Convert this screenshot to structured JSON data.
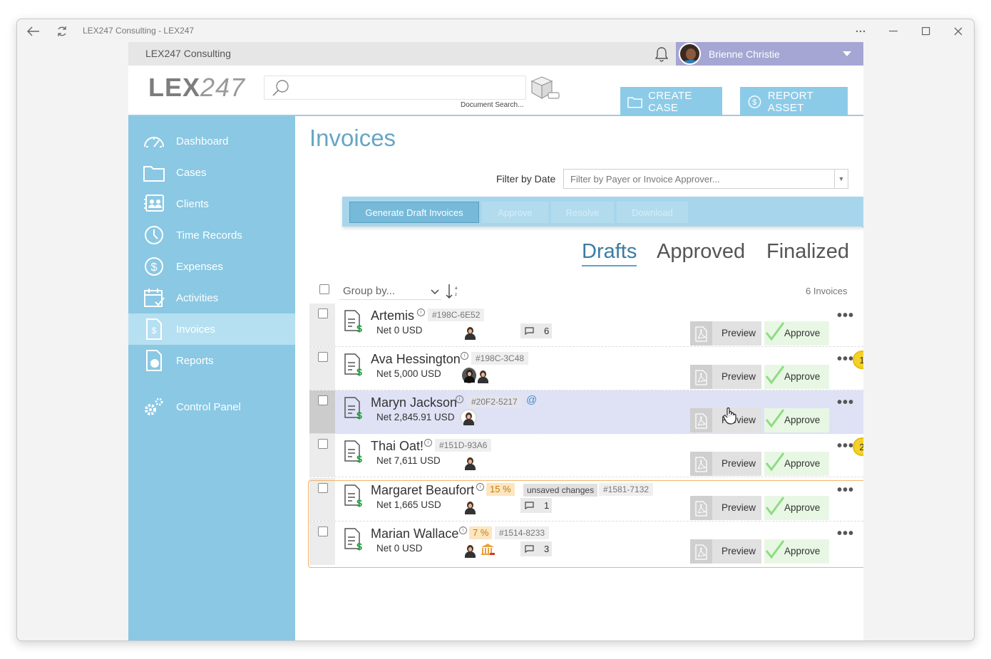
{
  "window": {
    "title": "LEX247 Consulting - LEX247"
  },
  "topbar": {
    "firm": "LEX247 Consulting",
    "user": "Brienne Christie"
  },
  "header": {
    "logo_bold": "LEX",
    "logo_light": "247",
    "search_caption": "Document Search...",
    "create_case": "CREATE CASE",
    "report_asset": "REPORT ASSET"
  },
  "sidebar": {
    "items": [
      {
        "label": "Dashboard",
        "icon": "gauge-icon"
      },
      {
        "label": "Cases",
        "icon": "folder-icon"
      },
      {
        "label": "Clients",
        "icon": "contacts-icon"
      },
      {
        "label": "Time Records",
        "icon": "clock-icon"
      },
      {
        "label": "Expenses",
        "icon": "dollar-icon"
      },
      {
        "label": "Activities",
        "icon": "calendar-icon"
      },
      {
        "label": "Invoices",
        "icon": "invoice-icon",
        "active": true
      },
      {
        "label": "Reports",
        "icon": "report-icon"
      },
      {
        "label": "Control Panel",
        "icon": "gears-icon"
      }
    ]
  },
  "main": {
    "title": "Invoices",
    "filter_label": "Filter by Date",
    "filter_placeholder": "Filter by Payer or Invoice Approver...",
    "toolbar": {
      "generate": "Generate Draft Invoices",
      "approve": "Approve",
      "resolve": "Resolve",
      "download": "Download"
    },
    "tabs": [
      "Drafts",
      "Approved",
      "Finalized"
    ],
    "active_tab": "Drafts",
    "group_by": "Group by...",
    "count": "6 Invoices",
    "preview_label": "Preview",
    "approve_label": "Approve",
    "invoices": [
      {
        "name": "Artemis",
        "id": "#198C-6E52",
        "net": "Net 0 USD",
        "comments": "6"
      },
      {
        "name": "Ava Hessington",
        "id": "#198C-3C48",
        "net": "Net 5,000 USD",
        "badge": "1"
      },
      {
        "name": "Maryn Jackson",
        "id": "#20F2-5217",
        "net": "Net 2,845.91 USD",
        "mention": "@"
      },
      {
        "name": "Thai Oat!",
        "id": "#151D-93A6",
        "net": "Net 7,611 USD",
        "badge": "2"
      },
      {
        "name": "Margaret Beaufort",
        "pct": "15 %",
        "status": "unsaved changes",
        "id": "#1581-7132",
        "net": "Net 1,665 USD",
        "comments": "1"
      },
      {
        "name": "Marian Wallace",
        "pct": "7 %",
        "id": "#1514-8233",
        "net": "Net 0 USD",
        "comments": "3"
      }
    ]
  },
  "colors": {
    "sidebar": "#8ac8e3",
    "accent": "#65a6c5",
    "approve": "#8fdc83",
    "badge": "#f4d12a",
    "user_bar": "#a6a6d4"
  }
}
